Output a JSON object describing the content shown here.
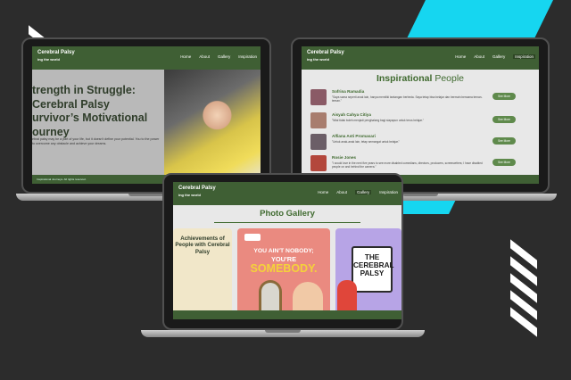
{
  "site": {
    "brand_title": "Cerebral Palsy",
    "brand_tagline": "ing the world",
    "nav": [
      "Home",
      "About",
      "Gallery",
      "Inspiration"
    ]
  },
  "hero": {
    "title": "trength in Struggle:\n Cerebral Palsy\nurvivor’s Motivational\nourney",
    "body": "ebral palsy may be a part of your life, but it doesn't define your potential. You to the power to overcome any obstacle and achieve your dreams.",
    "footer": "Inspirational Journeys. All rights reserved."
  },
  "inspirational": {
    "title_strong": "Inspirational",
    "title_light": "People",
    "see_more": "See More",
    "people": [
      {
        "name": "Sofrina Ramadia",
        "quote": "\"Saya sama seperti anak lain, hanya memiliki tantangan berbeda. Saya tetap bisa belajar dan bermain bersama teman-teman.\"",
        "color": "#8a5a66"
      },
      {
        "name": "Aisyah Cahya Citiya",
        "quote": "\"Nilai tidak boleh menjadi penghalang bagi siapapun untuk terus belajar.\"",
        "color": "#a87d6e"
      },
      {
        "name": "Alfiana Asti Promasari",
        "quote": "\"Untuk anak-anak lain, tetap semangat untuk belajar.\"",
        "color": "#6b5e67"
      },
      {
        "name": "Rosie Jones",
        "quote": "\"I would love in the next five years to see more disabled comedians, directors, producers, screenwriters; I have disabled people on and behind the camera.\"",
        "color": "#b3473c"
      }
    ]
  },
  "gallery": {
    "title": "Photo Gallery",
    "card1_title": "Achievements of People with Cerebral Palsy",
    "card2_line1": "YOU AIN'T NOBODY;",
    "card2_line2": "YOU'RE",
    "card2_line3": "SOMEBODY.",
    "card3_board": "THE\nCEREBRAL\nPALSY"
  },
  "colors": {
    "nav_green": "#3f5f34",
    "accent_green": "#3f6a2f",
    "cyan": "#16d6f0",
    "background": "#2c2c2c"
  }
}
